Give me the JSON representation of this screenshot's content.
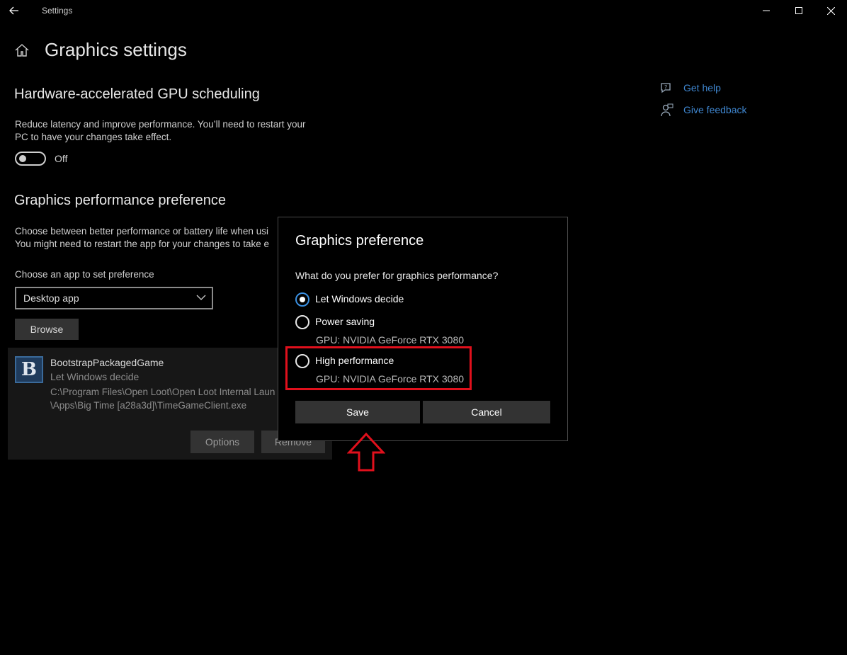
{
  "window": {
    "title": "Settings"
  },
  "page": {
    "title": "Graphics settings"
  },
  "gpu_scheduling": {
    "heading": "Hardware-accelerated GPU scheduling",
    "description_line1": "Reduce latency and improve performance. You’ll need to restart your",
    "description_line2": "PC to have your changes take effect.",
    "toggle_state": "Off"
  },
  "preference": {
    "heading": "Graphics performance preference",
    "description_line1": "Choose between better performance or battery life when usi",
    "description_line2": "You might need to restart the app for your changes to take e",
    "choose_label": "Choose an app to set preference",
    "select_value": "Desktop app",
    "browse_label": "Browse"
  },
  "app_entry": {
    "icon_letter": "B",
    "name": "BootstrapPackagedGame",
    "preference": "Let Windows decide",
    "path_line1": "C:\\Program Files\\Open Loot\\Open Loot Internal Laun",
    "path_line2": "\\Apps\\Big Time [a28a3d]\\TimeGameClient.exe",
    "options_label": "Options",
    "remove_label": "Remove"
  },
  "side_links": {
    "get_help": "Get help",
    "give_feedback": "Give feedback"
  },
  "dialog": {
    "title": "Graphics preference",
    "question": "What do you prefer for graphics performance?",
    "options": [
      {
        "label": "Let Windows decide",
        "selected": true
      },
      {
        "label": "Power saving",
        "gpu": "GPU: NVIDIA GeForce RTX 3080",
        "selected": false
      },
      {
        "label": "High performance",
        "gpu": "GPU: NVIDIA GeForce RTX 3080",
        "selected": false
      }
    ],
    "save_label": "Save",
    "cancel_label": "Cancel"
  },
  "annotation_color": "#e0101c",
  "accent_color": "#3a8fe0"
}
